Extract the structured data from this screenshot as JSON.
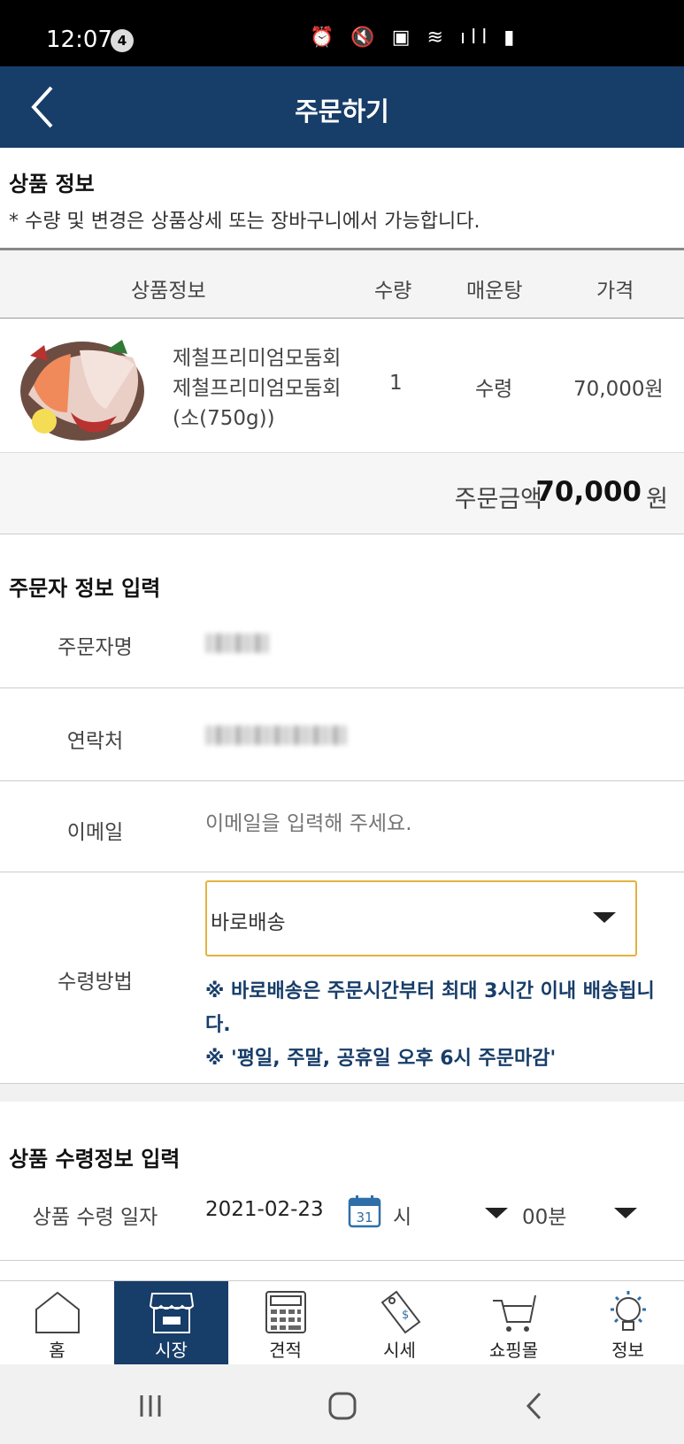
{
  "status_bar": {
    "time": "12:07",
    "badge": "4",
    "icons": "⏰ 🔇 ▣ ≋ ıll ▮"
  },
  "header": {
    "title": "주문하기"
  },
  "product_section": {
    "title": "상품 정보",
    "notice": "* 수량 및 변경은 상품상세 또는 장바구니에서 가능합니다.",
    "columns": [
      "상품정보",
      "수량",
      "매운탕",
      "가격"
    ],
    "items": [
      {
        "name": "제철프리미엄모둠회 제철프리미엄모둠회(소(750g))",
        "quantity": "1",
        "maeuntang": "수령",
        "price": "70,000원"
      }
    ],
    "total_label": "주문금액",
    "total_amount": "70,000",
    "total_unit": "원"
  },
  "orderer_section": {
    "title": "주문자 정보 입력",
    "name_label": "주문자명",
    "contact_label": "연락처",
    "email_label": "이메일",
    "email_placeholder": "이메일을 입력해 주세요.",
    "receive_label": "수령방법",
    "receive_selected": "바로배송",
    "notes": [
      "※ 바로배송은 주문시간부터 최대 3시간 이내 배송됩니다.",
      "※ '평일, 주말, 공휴일 오후 6시 주문마감'"
    ]
  },
  "receive_section": {
    "title": "상품 수령정보 입력",
    "date_label": "상품 수령 일자",
    "date_value": "2021-02-23",
    "calendar_day": "31",
    "hour_label": "시",
    "minute_value": "00분"
  },
  "bottom_nav": [
    {
      "label": "홈",
      "icon": "home-icon"
    },
    {
      "label": "시장",
      "icon": "market-store-icon"
    },
    {
      "label": "견적",
      "icon": "calculator-icon"
    },
    {
      "label": "시세",
      "icon": "price-tag-icon"
    },
    {
      "label": "쇼핑몰",
      "icon": "cart-icon"
    },
    {
      "label": "정보",
      "icon": "lightbulb-icon"
    }
  ],
  "colors": {
    "brand": "#173d69",
    "select_border": "#e3b33f"
  }
}
